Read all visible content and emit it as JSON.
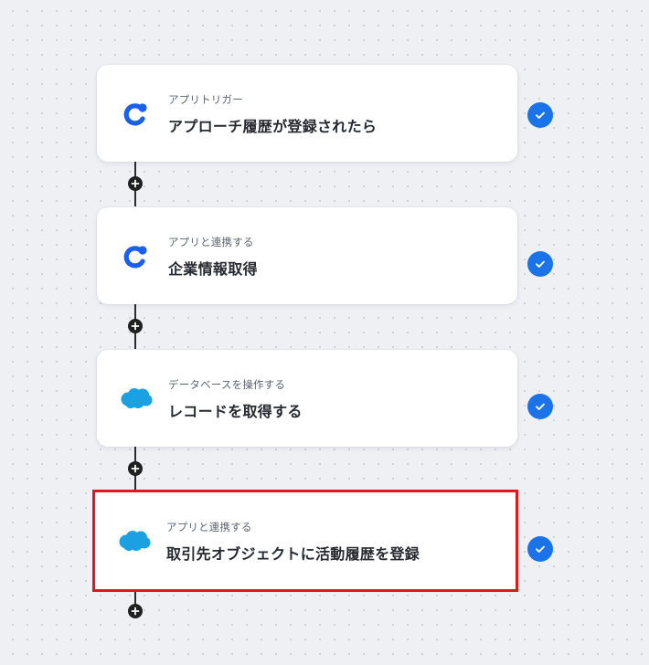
{
  "flow": {
    "steps": [
      {
        "category": "アプリトリガー",
        "title": "アプローチ履歴が登録されたら",
        "app_icon": "approach-app-icon",
        "status": "completed",
        "selected": false
      },
      {
        "category": "アプリと連携する",
        "title": "企業情報取得",
        "app_icon": "approach-app-icon",
        "status": "completed",
        "selected": false
      },
      {
        "category": "データベースを操作する",
        "title": "レコードを取得する",
        "app_icon": "salesforce-cloud-icon",
        "status": "completed",
        "selected": false
      },
      {
        "category": "アプリと連携する",
        "title": "取引先オブジェクトに活動履歴を登録",
        "app_icon": "salesforce-cloud-icon",
        "status": "completed",
        "selected": true
      }
    ]
  },
  "colors": {
    "background": "#eef0f4",
    "approach_brand": "#1a5ff0",
    "salesforce_brand": "#1ba0e2",
    "check_badge": "#1a73e8",
    "selection_outline": "#e4151c",
    "connector": "#1f1f1f"
  }
}
